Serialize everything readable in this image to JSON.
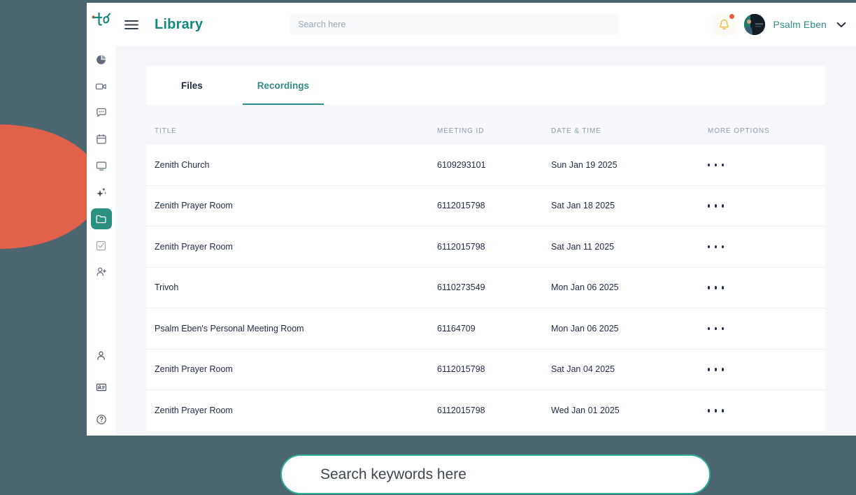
{
  "window": {
    "title": "Library"
  },
  "sidebar": {
    "logo_label": "to",
    "items": [
      {
        "label": "Dashboard",
        "icon": "pie-chart-icon",
        "active": false
      },
      {
        "label": "Meetings",
        "icon": "video-camera-icon",
        "active": false
      },
      {
        "label": "Chat",
        "icon": "chat-bubble-icon",
        "active": false
      },
      {
        "label": "Calendar",
        "icon": "calendar-icon",
        "active": false
      },
      {
        "label": "Screen",
        "icon": "monitor-icon",
        "active": false
      },
      {
        "label": "AI Assist",
        "icon": "sparkle-icon",
        "active": false
      },
      {
        "label": "Library",
        "icon": "folder-icon",
        "active": true
      },
      {
        "label": "Tasks",
        "icon": "task-check-icon",
        "active": false
      },
      {
        "label": "Contacts",
        "icon": "add-person-icon",
        "active": false
      }
    ],
    "bottom_items": [
      {
        "label": "Profile",
        "icon": "person-icon"
      },
      {
        "label": "Contacts",
        "icon": "id-card-icon"
      },
      {
        "label": "Help",
        "icon": "help-circle-icon"
      }
    ]
  },
  "topbar": {
    "menu_icon": "hamburger-icon",
    "search": {
      "value": "",
      "placeholder": "Search here"
    },
    "notification": {
      "icon": "bell-icon",
      "has_unread": true,
      "dot_color": "#ea5a3d",
      "bell_color": "#f1b434"
    },
    "user": {
      "name": "Psalm Eben",
      "chevron_icon": "chevron-down-icon"
    }
  },
  "tabs": [
    {
      "label": "Files",
      "active": false
    },
    {
      "label": "Recordings",
      "active": true
    }
  ],
  "table": {
    "columns": [
      "TITLE",
      "MEETING ID",
      "DATE & TIME",
      "MORE OPTIONS"
    ],
    "rows": [
      {
        "title": "Zenith Church",
        "meeting_id": "6109293101",
        "date": "Sun Jan 19 2025",
        "more": "more-options-icon"
      },
      {
        "title": "Zenith Prayer Room",
        "meeting_id": "6112015798",
        "date": "Sat Jan 18 2025",
        "more": "more-options-icon"
      },
      {
        "title": "Zenith Prayer Room",
        "meeting_id": "6112015798",
        "date": "Sat Jan 11 2025",
        "more": "more-options-icon"
      },
      {
        "title": "Trivoh",
        "meeting_id": "6110273549",
        "date": "Mon Jan 06 2025",
        "more": "more-options-icon"
      },
      {
        "title": "Psalm Eben's Personal Meeting Room",
        "meeting_id": "61164709",
        "date": "Mon Jan 06 2025",
        "more": "more-options-icon"
      },
      {
        "title": "Zenith Prayer Room",
        "meeting_id": "6112015798",
        "date": "Sat Jan 04 2025",
        "more": "more-options-icon"
      },
      {
        "title": "Zenith Prayer Room",
        "meeting_id": "6112015798",
        "date": "Wed Jan 01 2025",
        "more": "more-options-icon"
      }
    ]
  },
  "bottom_search": {
    "text": "Search keywords here"
  },
  "colors": {
    "backdrop": "#4c6670",
    "blob": "#e2614a",
    "accent_teal": "#2f8d85",
    "title_teal": "#12897c",
    "active_nav": "#2d9182",
    "content_bg": "#f5f7fa",
    "text_dark": "#1f2a44",
    "muted": "#8d9aa9"
  }
}
